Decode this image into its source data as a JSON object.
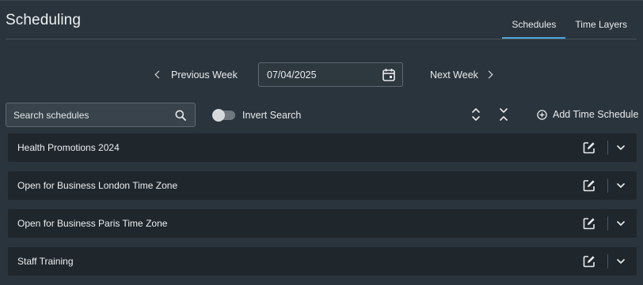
{
  "header": {
    "title": "Scheduling",
    "tabs": [
      {
        "label": "Schedules",
        "active": true
      },
      {
        "label": "Time Layers",
        "active": false
      }
    ]
  },
  "week_nav": {
    "previous_label": "Previous Week",
    "next_label": "Next Week",
    "date_value": "07/04/2025"
  },
  "toolbar": {
    "search_placeholder": "Search schedules",
    "search_value": "",
    "invert_search_label": "Invert Search",
    "invert_search_on": false,
    "add_label": "Add Time Schedule"
  },
  "schedules": [
    {
      "name": "Health Promotions 2024"
    },
    {
      "name": "Open for Business London Time Zone"
    },
    {
      "name": "Open for Business Paris Time Zone"
    },
    {
      "name": "Staff Training"
    }
  ],
  "icons": {
    "calendar": "calendar-icon",
    "search": "search-icon",
    "expand_all": "expand-all-icon",
    "collapse_all": "collapse-all-icon",
    "add": "plus-circle-icon",
    "edit": "edit-icon",
    "row_expand": "chevron-down-icon"
  },
  "colors": {
    "background": "#2a343c",
    "row_background": "#1f272d",
    "accent": "#4da3d9",
    "text": "#e8ebed"
  }
}
